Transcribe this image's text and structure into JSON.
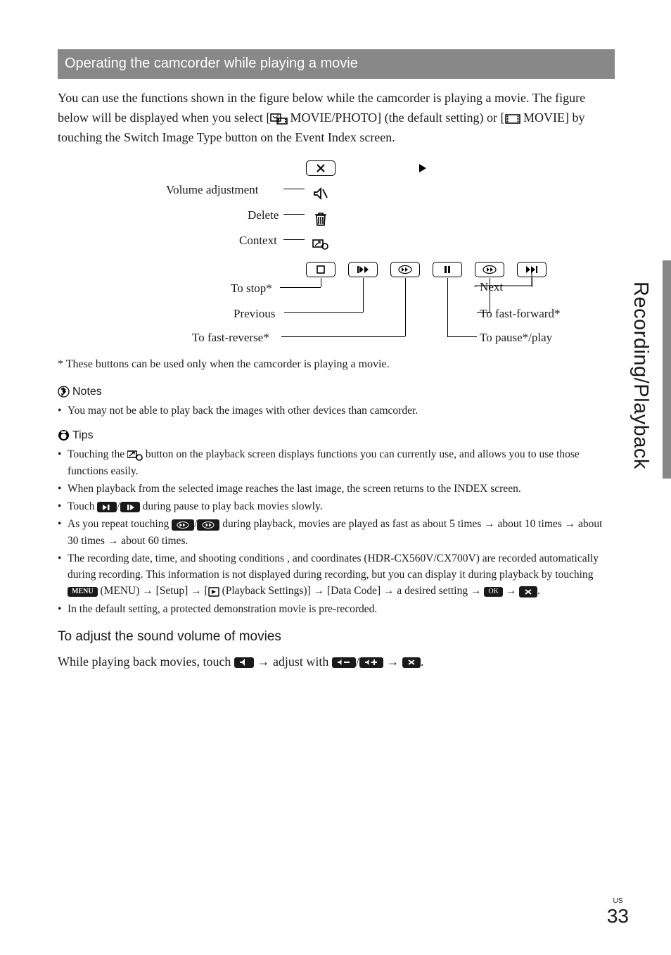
{
  "header": "Operating the camcorder while playing a movie",
  "intro": "You can use the functions shown in the figure below while the camcorder is playing a movie. The figure below will be displayed when you select [       MOVIE/PHOTO] (the default setting) or [       MOVIE] by touching the Switch Image Type button on the Event Index screen.",
  "diagram": {
    "volume": "Volume adjustment",
    "delete": "Delete",
    "context": "Context",
    "stop": "To stop*",
    "previous": "Previous",
    "fastrev": "To fast-reverse*",
    "next": "Next",
    "fastfwd": "To fast-forward*",
    "pause": "To pause*/play"
  },
  "footnote": "* These buttons can be used only when the camcorder is playing a movie.",
  "notes_hdr": "Notes",
  "notes": [
    "You may not be able to play back the images with other devices than camcorder."
  ],
  "tips_hdr": "Tips",
  "tip1_a": "Touching the ",
  "tip1_b": " button on the playback screen displays functions you can currently use, and allows you to use those functions easily.",
  "tip2": "When playback from the selected image reaches the last image, the screen returns to the INDEX screen.",
  "tip3_a": "Touch ",
  "tip3_b": " during pause to play back movies slowly.",
  "tip4_a": "As you repeat touching ",
  "tip4_b": " during playback, movies are played as fast as about 5 times → about 10 times → about 30 times → about 60 times.",
  "tip5_a": "The recording date, time, and shooting conditions , and coordinates (HDR-CX560V/CX700V) are recorded automatically during recording. This information is not displayed during recording, but you can display it during playback by touching ",
  "tip5_menu": "MENU",
  "tip5_b": " (MENU) → [Setup] → [",
  "tip5_c": " (Playback Settings)] → [Data Code] → a desired setting → ",
  "tip5_ok": "OK",
  "tip6": "In the default setting, a protected demonstration movie is pre-recorded.",
  "sub_hdr": "To adjust the sound volume of movies",
  "adjust_a": "While playing back movies, touch ",
  "adjust_b": " → adjust with ",
  "adjust_c": " → ",
  "side": "Recording/Playback",
  "page_us": "US",
  "page_n": "33"
}
